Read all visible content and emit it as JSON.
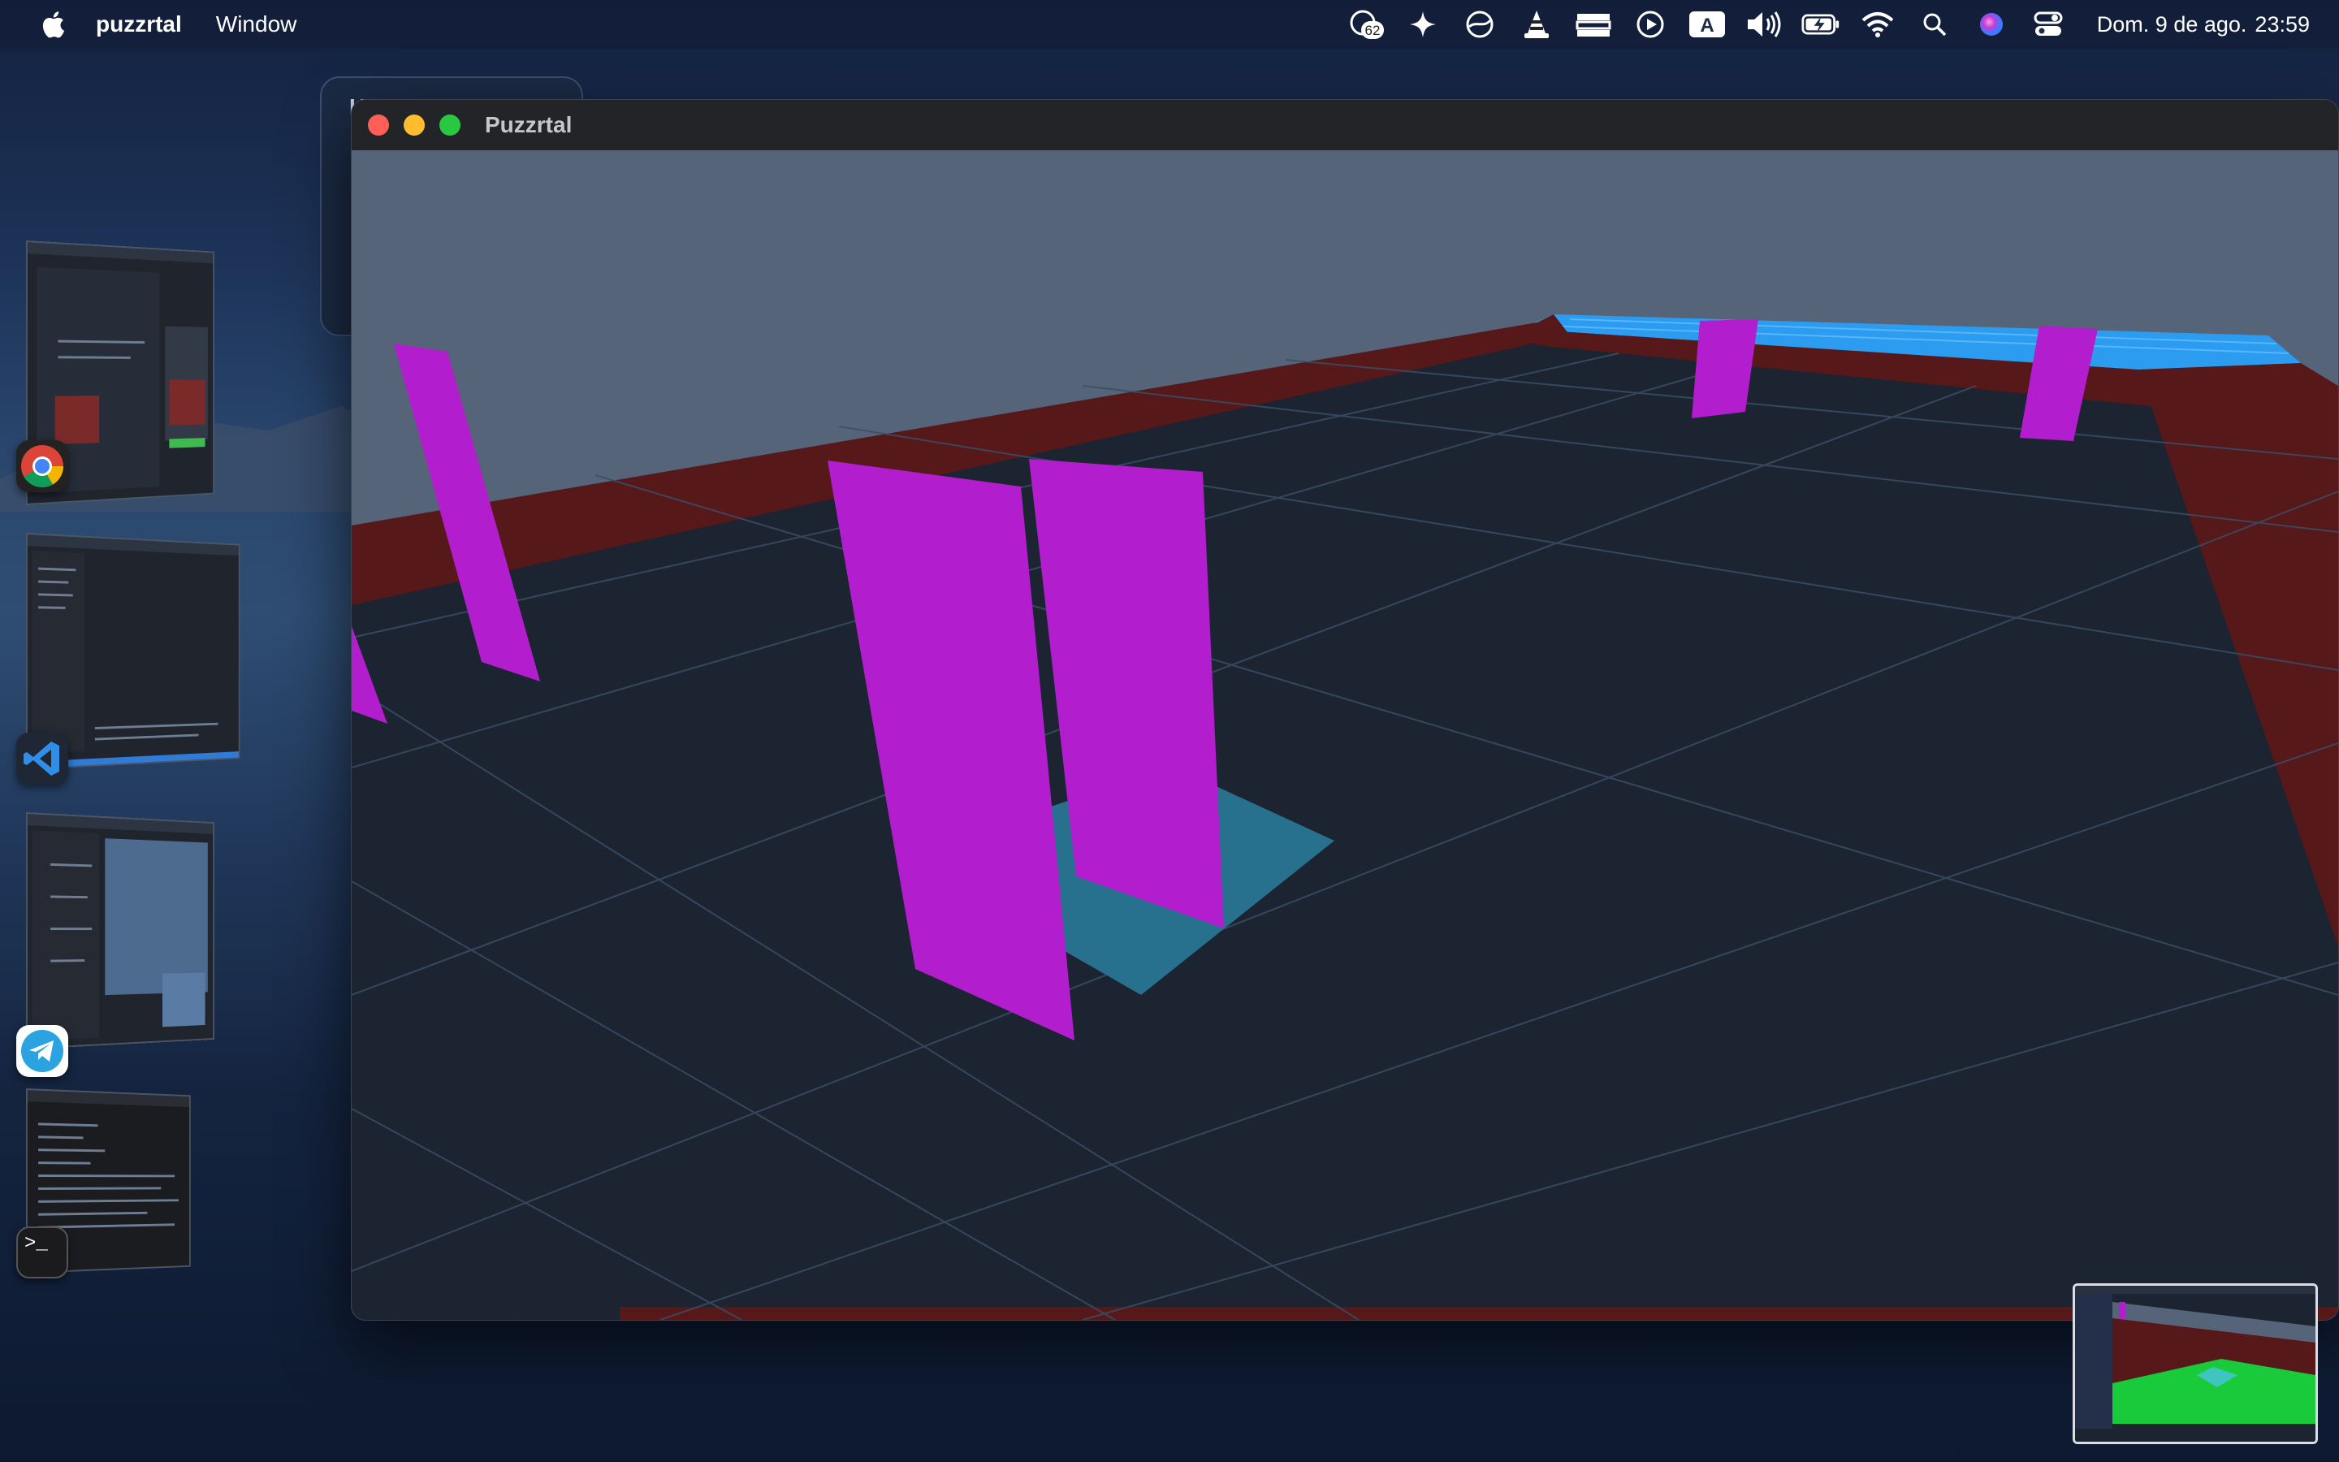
{
  "menubar": {
    "app_name": "puzzrtal",
    "menus": [
      "Window"
    ],
    "status_icons": [
      {
        "name": "notification-badge-icon",
        "badge": "62"
      },
      {
        "name": "sparkle-icon"
      },
      {
        "name": "globe-vpn-icon"
      },
      {
        "name": "vlc-cone-icon"
      },
      {
        "name": "stack-icon"
      },
      {
        "name": "play-circle-icon"
      },
      {
        "name": "input-source-icon",
        "label": "A"
      },
      {
        "name": "volume-icon"
      },
      {
        "name": "battery-charging-icon"
      },
      {
        "name": "wifi-icon"
      },
      {
        "name": "search-icon"
      },
      {
        "name": "siri-icon"
      },
      {
        "name": "control-center-icon"
      }
    ],
    "date": "Dom. 9 de ago.",
    "time": "23:59"
  },
  "background_window": {
    "title_fragment": "H"
  },
  "stage_manager": {
    "apps": [
      {
        "name": "chrome",
        "icon": "chrome-icon"
      },
      {
        "name": "vscode",
        "icon": "vscode-icon"
      },
      {
        "name": "telegram",
        "icon": "telegram-icon"
      },
      {
        "name": "terminal",
        "icon": "terminal-icon",
        "label": ">_"
      }
    ]
  },
  "window": {
    "title": "Puzzrtal"
  },
  "scene": {
    "colors": {
      "sky": "#566479",
      "floor": "#1c2431",
      "grid": "#3a4e66",
      "wall_red": "#571819",
      "wall_blue": "#2b9cf0",
      "portal_magenta": "#b21ecd",
      "pad_teal": "#27708e",
      "preview_green": "#19cb3a"
    }
  }
}
